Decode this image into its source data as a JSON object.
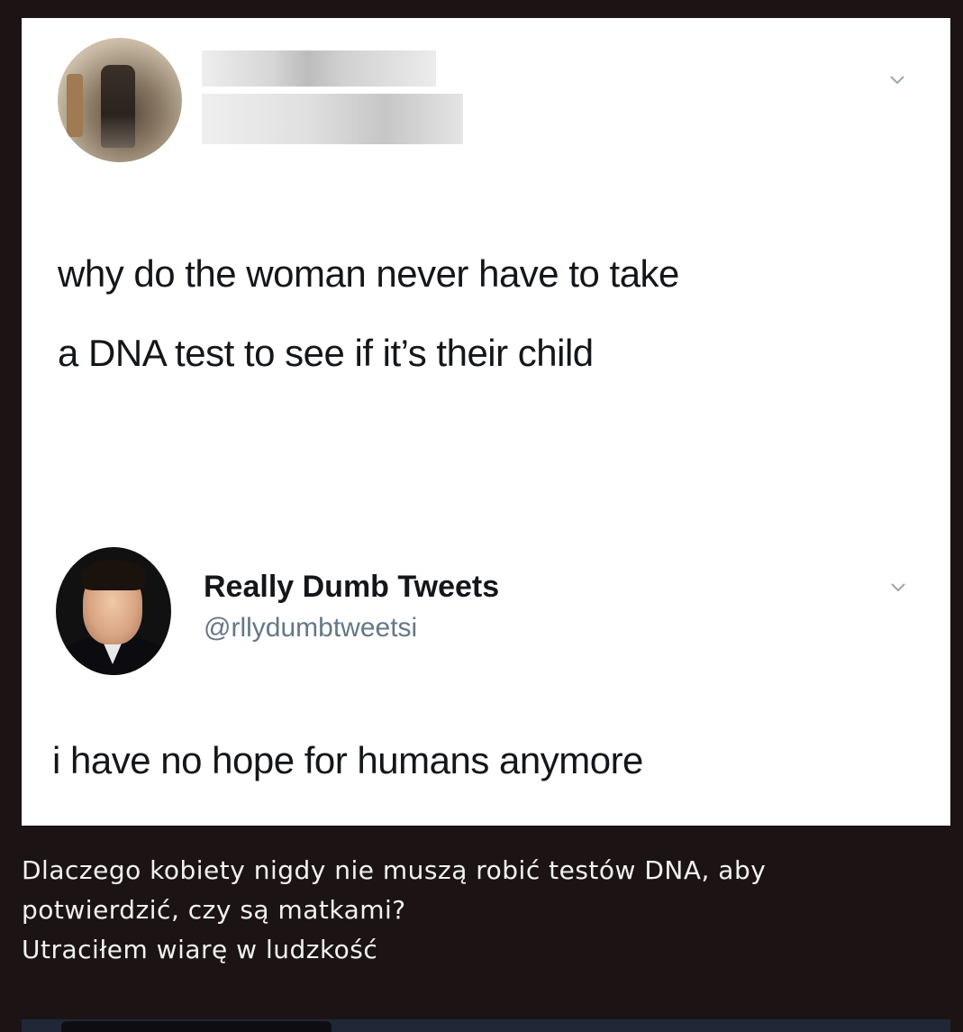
{
  "tweet1": {
    "text_line1": "why do the woman never have to take",
    "text_line2": "a DNA test to see if it’s their child"
  },
  "tweet2": {
    "display_name": "Really Dumb Tweets",
    "handle": "@rllydumbtweetsi",
    "text": "i have no hope for humans anymore"
  },
  "caption": {
    "line1": "Dlaczego kobiety nigdy nie muszą robić testów DNA, aby",
    "line2": "potwierdzić, czy są matkami?",
    "line3": "Utraciłem wiarę w ludzkość"
  },
  "colors": {
    "background": "#1c1414",
    "card": "#ffffff",
    "tweet_text": "#14171a",
    "handle_text": "#657786",
    "caption_text": "#f2f2f2"
  },
  "icons": [
    "chevron-down-icon"
  ]
}
